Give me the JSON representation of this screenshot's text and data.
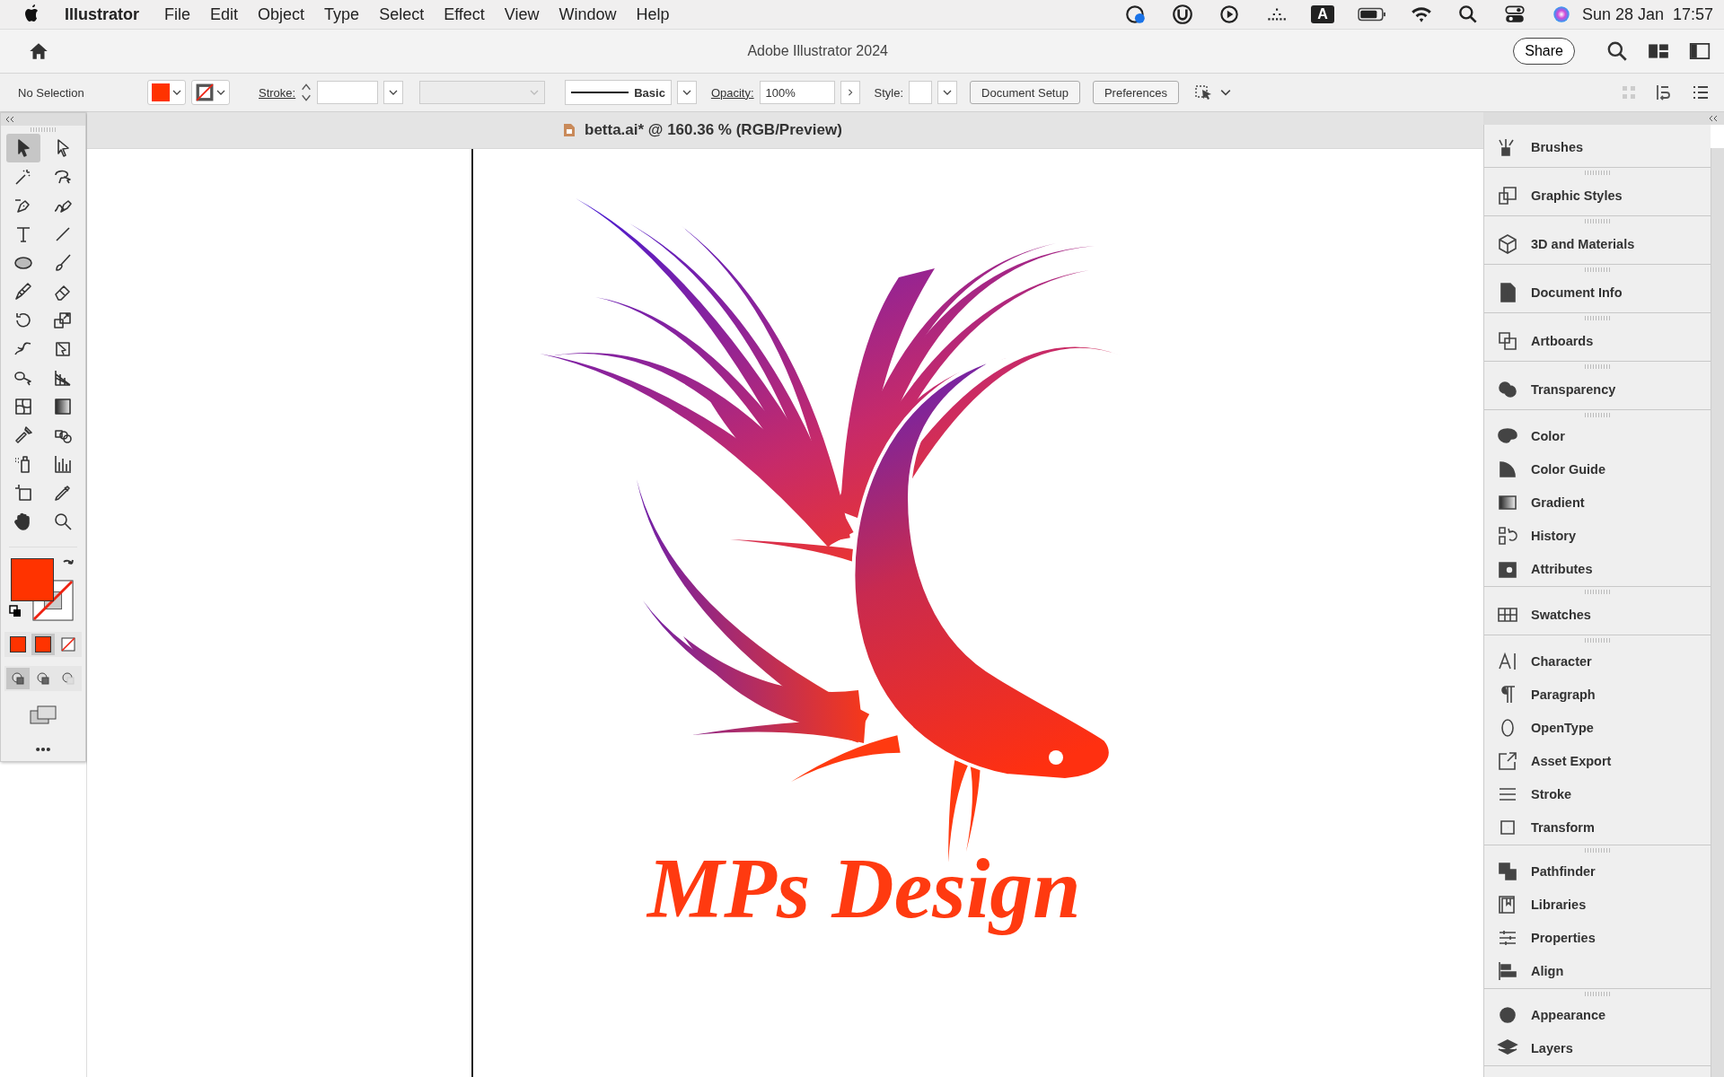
{
  "menubar": {
    "app": "Illustrator",
    "menus": [
      "File",
      "Edit",
      "Object",
      "Type",
      "Select",
      "Effect",
      "View",
      "Window",
      "Help"
    ],
    "input_source": "A",
    "date": "Sun 28 Jan",
    "time": "17:57"
  },
  "app_bar": {
    "title": "Adobe Illustrator 2024",
    "share": "Share"
  },
  "control_bar": {
    "selection": "No Selection",
    "stroke_label": "Stroke:",
    "brush": "Basic",
    "opacity_label": "Opacity:",
    "opacity": "100%",
    "style_label": "Style:",
    "buttons": [
      "Document Setup",
      "Preferences"
    ]
  },
  "document": {
    "tab": "betta.ai* @ 160.36 % (RGB/Preview)",
    "artwork_text": "MPs Design"
  },
  "tools": [
    {
      "selected": true
    },
    {
      "selected": false
    },
    {
      "selected": false
    },
    {
      "selected": false
    },
    {
      "selected": false
    },
    {
      "selected": false
    },
    {
      "selected": false
    },
    {
      "selected": false
    },
    {
      "selected": false
    },
    {
      "selected": false
    },
    {
      "selected": false
    },
    {
      "selected": false
    },
    {
      "selected": false
    },
    {
      "selected": false
    },
    {
      "selected": false
    },
    {
      "selected": false
    },
    {
      "selected": false
    },
    {
      "selected": false
    },
    {
      "selected": false
    },
    {
      "selected": false
    },
    {
      "selected": false
    },
    {
      "selected": false
    },
    {
      "selected": false
    },
    {
      "selected": false
    },
    {
      "selected": false
    },
    {
      "selected": false
    },
    {
      "selected": false
    },
    {
      "selected": false
    }
  ],
  "fill_modes": [
    {
      "selected": false
    },
    {
      "selected": true
    },
    {
      "selected": false
    }
  ],
  "draw_modes": [
    {
      "selected": true
    },
    {
      "selected": false
    },
    {
      "selected": false
    }
  ],
  "panels": [
    [
      {
        "label": "Brushes"
      }
    ],
    [
      {
        "label": "Graphic Styles"
      }
    ],
    [
      {
        "label": "3D and Materials"
      }
    ],
    [
      {
        "label": "Document Info"
      }
    ],
    [
      {
        "label": "Artboards"
      }
    ],
    [
      {
        "label": "Transparency"
      }
    ],
    [
      {
        "label": "Color"
      },
      {
        "label": "Color Guide"
      },
      {
        "label": "Gradient"
      },
      {
        "label": "History"
      },
      {
        "label": "Attributes"
      }
    ],
    [
      {
        "label": "Swatches"
      }
    ],
    [
      {
        "label": "Character"
      },
      {
        "label": "Paragraph"
      },
      {
        "label": "OpenType"
      },
      {
        "label": "Asset Export"
      },
      {
        "label": "Stroke"
      },
      {
        "label": "Transform"
      }
    ],
    [
      {
        "label": "Pathfinder"
      },
      {
        "label": "Libraries"
      },
      {
        "label": "Properties"
      },
      {
        "label": "Align"
      }
    ],
    [
      {
        "label": "Appearance"
      },
      {
        "label": "Layers"
      }
    ]
  ]
}
